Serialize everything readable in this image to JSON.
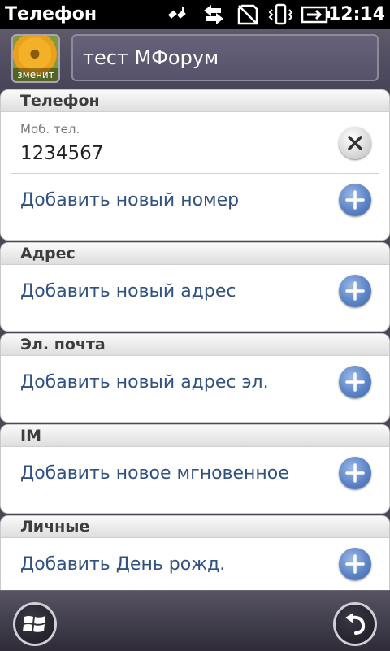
{
  "status": {
    "app_title": "Телефон",
    "time": "12:14",
    "icons": [
      "signal-off-icon",
      "data-transfer-icon",
      "no-sim-icon",
      "vibrate-icon",
      "battery-charging-icon"
    ]
  },
  "contact": {
    "name": "тест МФорум",
    "avatar_label": "зменит"
  },
  "sections": {
    "phone": {
      "header": "Телефон",
      "field_caption": "Моб. тел.",
      "field_value": "1234567",
      "add_label": "Добавить новый номер"
    },
    "address": {
      "header": "Адрес",
      "add_label": "Добавить новый адрес"
    },
    "email": {
      "header": "Эл. почта",
      "add_label": "Добавить новый адрес эл."
    },
    "im": {
      "header": "IM",
      "add_label": "Добавить новое мгновенное"
    },
    "personal": {
      "header": "Личные",
      "add_label": "Добавить День рожд."
    }
  },
  "colors": {
    "accent_blue": "#5c84c7",
    "label_blue": "#31527f",
    "header_purple": "#4a4654"
  }
}
